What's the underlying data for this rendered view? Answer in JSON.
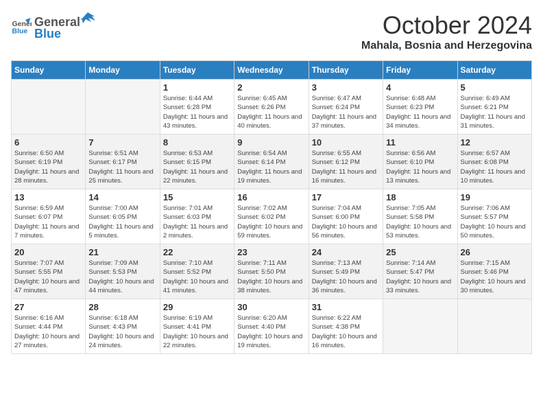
{
  "header": {
    "logo_general": "General",
    "logo_blue": "Blue",
    "month": "October 2024",
    "location": "Mahala, Bosnia and Herzegovina"
  },
  "days_of_week": [
    "Sunday",
    "Monday",
    "Tuesday",
    "Wednesday",
    "Thursday",
    "Friday",
    "Saturday"
  ],
  "weeks": [
    [
      {
        "day": "",
        "empty": true
      },
      {
        "day": "",
        "empty": true
      },
      {
        "day": "1",
        "sunrise": "6:44 AM",
        "sunset": "6:28 PM",
        "daylight": "11 hours and 43 minutes."
      },
      {
        "day": "2",
        "sunrise": "6:45 AM",
        "sunset": "6:26 PM",
        "daylight": "11 hours and 40 minutes."
      },
      {
        "day": "3",
        "sunrise": "6:47 AM",
        "sunset": "6:24 PM",
        "daylight": "11 hours and 37 minutes."
      },
      {
        "day": "4",
        "sunrise": "6:48 AM",
        "sunset": "6:23 PM",
        "daylight": "11 hours and 34 minutes."
      },
      {
        "day": "5",
        "sunrise": "6:49 AM",
        "sunset": "6:21 PM",
        "daylight": "11 hours and 31 minutes."
      }
    ],
    [
      {
        "day": "6",
        "sunrise": "6:50 AM",
        "sunset": "6:19 PM",
        "daylight": "11 hours and 28 minutes."
      },
      {
        "day": "7",
        "sunrise": "6:51 AM",
        "sunset": "6:17 PM",
        "daylight": "11 hours and 25 minutes."
      },
      {
        "day": "8",
        "sunrise": "6:53 AM",
        "sunset": "6:15 PM",
        "daylight": "11 hours and 22 minutes."
      },
      {
        "day": "9",
        "sunrise": "6:54 AM",
        "sunset": "6:14 PM",
        "daylight": "11 hours and 19 minutes."
      },
      {
        "day": "10",
        "sunrise": "6:55 AM",
        "sunset": "6:12 PM",
        "daylight": "11 hours and 16 minutes."
      },
      {
        "day": "11",
        "sunrise": "6:56 AM",
        "sunset": "6:10 PM",
        "daylight": "11 hours and 13 minutes."
      },
      {
        "day": "12",
        "sunrise": "6:57 AM",
        "sunset": "6:08 PM",
        "daylight": "11 hours and 10 minutes."
      }
    ],
    [
      {
        "day": "13",
        "sunrise": "6:59 AM",
        "sunset": "6:07 PM",
        "daylight": "11 hours and 7 minutes."
      },
      {
        "day": "14",
        "sunrise": "7:00 AM",
        "sunset": "6:05 PM",
        "daylight": "11 hours and 5 minutes."
      },
      {
        "day": "15",
        "sunrise": "7:01 AM",
        "sunset": "6:03 PM",
        "daylight": "11 hours and 2 minutes."
      },
      {
        "day": "16",
        "sunrise": "7:02 AM",
        "sunset": "6:02 PM",
        "daylight": "10 hours and 59 minutes."
      },
      {
        "day": "17",
        "sunrise": "7:04 AM",
        "sunset": "6:00 PM",
        "daylight": "10 hours and 56 minutes."
      },
      {
        "day": "18",
        "sunrise": "7:05 AM",
        "sunset": "5:58 PM",
        "daylight": "10 hours and 53 minutes."
      },
      {
        "day": "19",
        "sunrise": "7:06 AM",
        "sunset": "5:57 PM",
        "daylight": "10 hours and 50 minutes."
      }
    ],
    [
      {
        "day": "20",
        "sunrise": "7:07 AM",
        "sunset": "5:55 PM",
        "daylight": "10 hours and 47 minutes."
      },
      {
        "day": "21",
        "sunrise": "7:09 AM",
        "sunset": "5:53 PM",
        "daylight": "10 hours and 44 minutes."
      },
      {
        "day": "22",
        "sunrise": "7:10 AM",
        "sunset": "5:52 PM",
        "daylight": "10 hours and 41 minutes."
      },
      {
        "day": "23",
        "sunrise": "7:11 AM",
        "sunset": "5:50 PM",
        "daylight": "10 hours and 38 minutes."
      },
      {
        "day": "24",
        "sunrise": "7:13 AM",
        "sunset": "5:49 PM",
        "daylight": "10 hours and 36 minutes."
      },
      {
        "day": "25",
        "sunrise": "7:14 AM",
        "sunset": "5:47 PM",
        "daylight": "10 hours and 33 minutes."
      },
      {
        "day": "26",
        "sunrise": "7:15 AM",
        "sunset": "5:46 PM",
        "daylight": "10 hours and 30 minutes."
      }
    ],
    [
      {
        "day": "27",
        "sunrise": "6:16 AM",
        "sunset": "4:44 PM",
        "daylight": "10 hours and 27 minutes."
      },
      {
        "day": "28",
        "sunrise": "6:18 AM",
        "sunset": "4:43 PM",
        "daylight": "10 hours and 24 minutes."
      },
      {
        "day": "29",
        "sunrise": "6:19 AM",
        "sunset": "4:41 PM",
        "daylight": "10 hours and 22 minutes."
      },
      {
        "day": "30",
        "sunrise": "6:20 AM",
        "sunset": "4:40 PM",
        "daylight": "10 hours and 19 minutes."
      },
      {
        "day": "31",
        "sunrise": "6:22 AM",
        "sunset": "4:38 PM",
        "daylight": "10 hours and 16 minutes."
      },
      {
        "day": "",
        "empty": true
      },
      {
        "day": "",
        "empty": true
      }
    ]
  ]
}
